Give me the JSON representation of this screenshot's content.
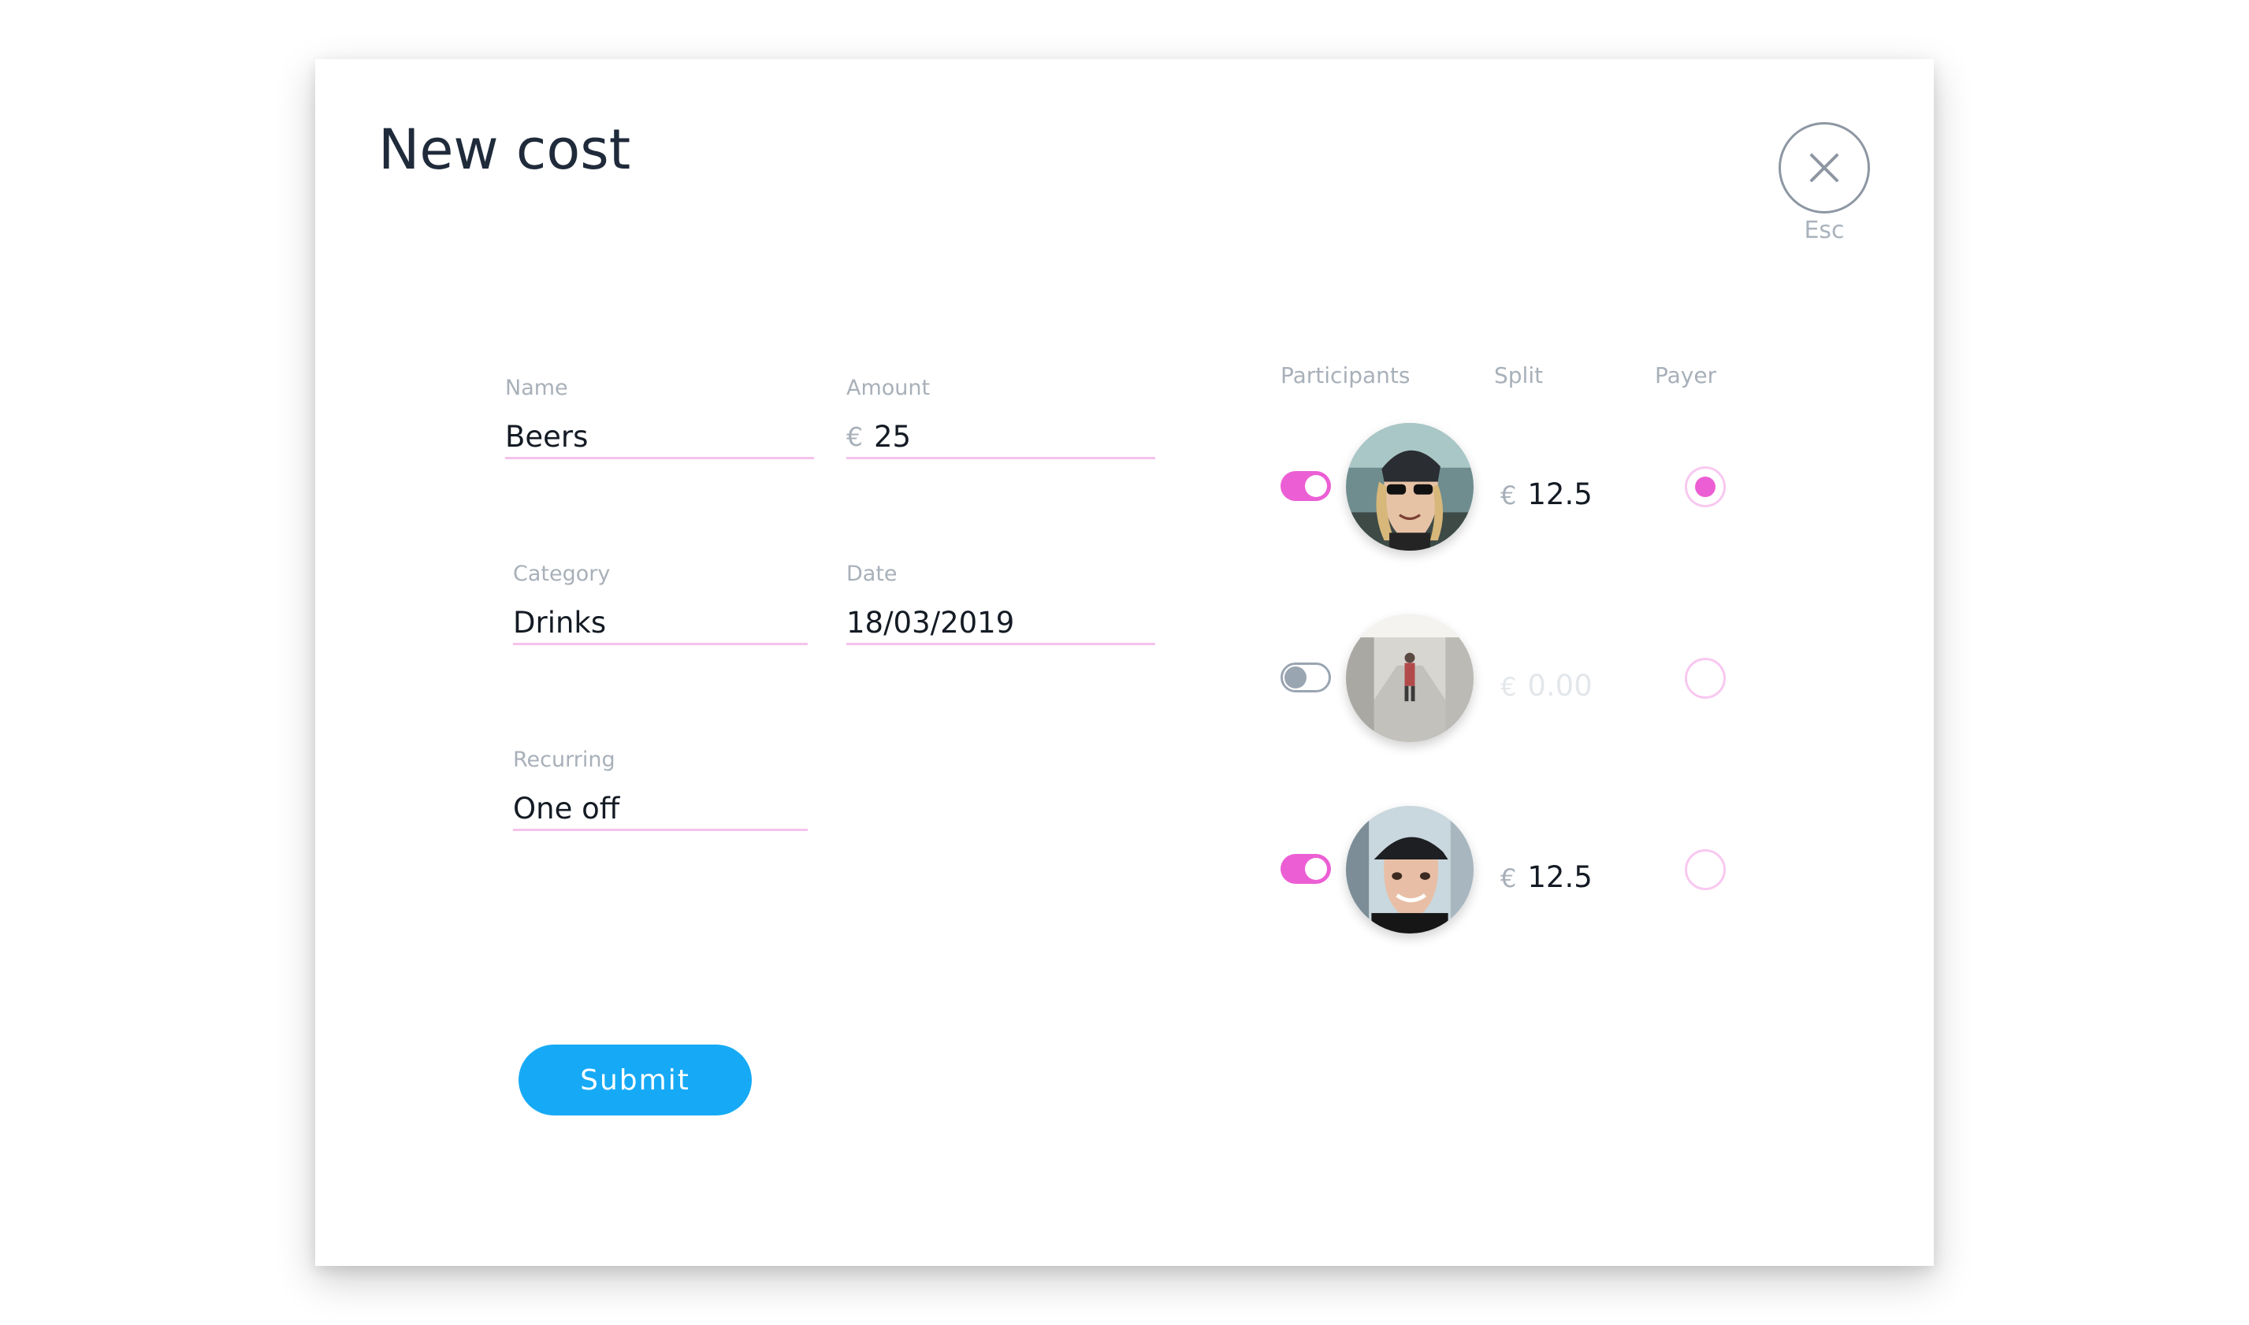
{
  "modal": {
    "title": "New cost",
    "close": {
      "icon": "close-icon",
      "label": "Esc"
    }
  },
  "form": {
    "name": {
      "label": "Name",
      "value": "Beers"
    },
    "amount": {
      "label": "Amount",
      "currency": "€",
      "value": "25"
    },
    "category": {
      "label": "Category",
      "value": "Drinks"
    },
    "date": {
      "label": "Date",
      "value": "18/03/2019"
    },
    "recurring": {
      "label": "Recurring",
      "value": "One off"
    },
    "submit_label": "Submit"
  },
  "participants": {
    "headers": {
      "participants": "Participants",
      "split": "Split",
      "payer": "Payer"
    },
    "rows": [
      {
        "active": true,
        "currency": "€",
        "split": "12.5",
        "payer": true
      },
      {
        "active": false,
        "currency": "€",
        "split": "0.00",
        "payer": false
      },
      {
        "active": true,
        "currency": "€",
        "split": "12.5",
        "payer": false
      }
    ]
  },
  "colors": {
    "accent_pink": "#ec5fd4",
    "submit_blue": "#16aaf6",
    "underline_pink": "#f4c2ec",
    "muted_gray": "#a8b0b9"
  }
}
